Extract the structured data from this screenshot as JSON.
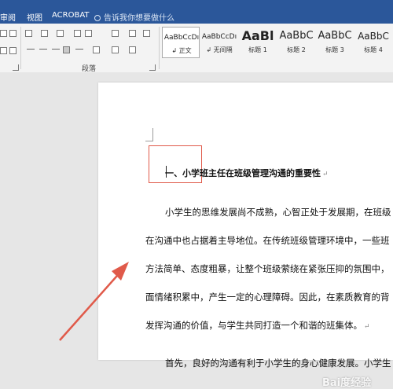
{
  "app": {
    "title": ""
  },
  "tabs": [
    {
      "label": "审阅"
    },
    {
      "label": "视图"
    },
    {
      "label": "ACROBAT"
    }
  ],
  "tell_me": {
    "placeholder": "告诉我你想要做什么"
  },
  "ribbon": {
    "paragraph_group_label": "段落",
    "styles": [
      {
        "preview": "AaBbCcDı",
        "name": "正文",
        "selected": true
      },
      {
        "preview": "AaBbCcDı",
        "name": "无间隔"
      },
      {
        "preview": "AaBl",
        "name": "标题 1"
      },
      {
        "preview": "AaBbC",
        "name": "标题 2"
      },
      {
        "preview": "AaBbC",
        "name": "标题 3"
      },
      {
        "preview": "AaBbC",
        "name": "标题 4"
      }
    ]
  },
  "document": {
    "heading": "一、小学班主任在班级管理沟通的重要性",
    "lines": [
      "小学生的思维发展尚不成熟，心智正处于发展期，在班级",
      "在沟通中也占据着主导地位。在传统班级管理环境中，一些班",
      "方法简单、态度粗暴，让整个班级萦绕在紧张压抑的氛围中，",
      "面情绪积累中，产生一定的心理障碍。因此，在素质教育的背",
      "发挥沟通的价值，与学生共同打造一个和谐的班集体。",
      "首先，良好的沟通有利于小学生的身心健康发展。小学生"
    ],
    "paragraph_mark": "↵"
  },
  "watermark": "Bai度经验",
  "colors": {
    "accent": "#2b579a",
    "annotation": "#e05a4a"
  }
}
